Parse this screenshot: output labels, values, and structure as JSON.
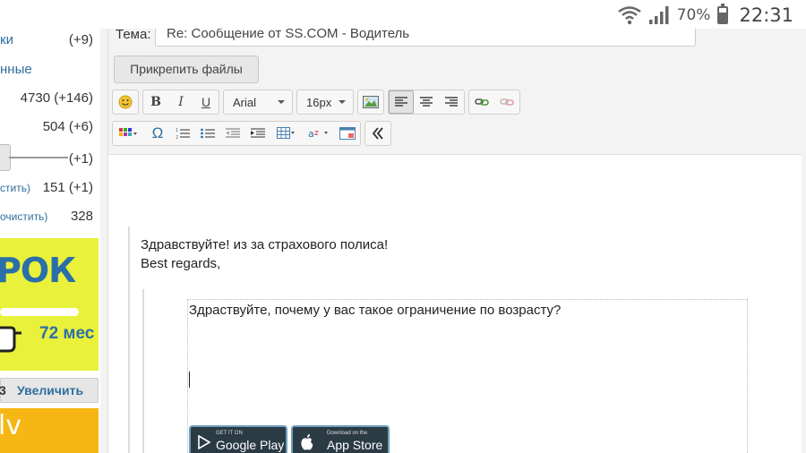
{
  "status_bar": {
    "battery_percent": "70%",
    "battery_level": 0.7,
    "time": "22:31"
  },
  "sidebar": {
    "rows": [
      {
        "left": "ки",
        "right": "(+9)"
      },
      {
        "left": "нные",
        "right": ""
      },
      {
        "left": "",
        "right": "4730 (+146)"
      },
      {
        "left": "",
        "right": "504 (+6)"
      },
      {
        "left": "",
        "right": "(+1)"
      },
      {
        "left": "стить)",
        "right": "151 (+1)"
      },
      {
        "left": "очистить)",
        "right": "328"
      }
    ],
    "ad_banner": {
      "big_text": "РОК",
      "months": "72 мес"
    },
    "enlarge": {
      "count": "3",
      "label": "Увеличить"
    },
    "ad_orange_text": "lv"
  },
  "form": {
    "subject_label": "Тема:",
    "subject_value": "Re: Сообщение от SS.COM - Водитель",
    "attach_label": "Прикрепить файлы"
  },
  "toolbar": {
    "font_family": "Arial",
    "font_size": "16px"
  },
  "editor": {
    "line1": "Здравствуйте! из за страхового полиса!",
    "line2": "Best regards,",
    "quoted_text": "Здраствуйте, почему у вас такое ограничение по возрасту?",
    "google_play_small": "GET IT ON",
    "google_play_big": "Google Play",
    "app_store_small": "Download on the",
    "app_store_big": "App Store"
  },
  "colors": {
    "link_blue": "#2f6f9f",
    "ad_yellow": "#eaf13a",
    "ad_orange": "#f6b613"
  }
}
